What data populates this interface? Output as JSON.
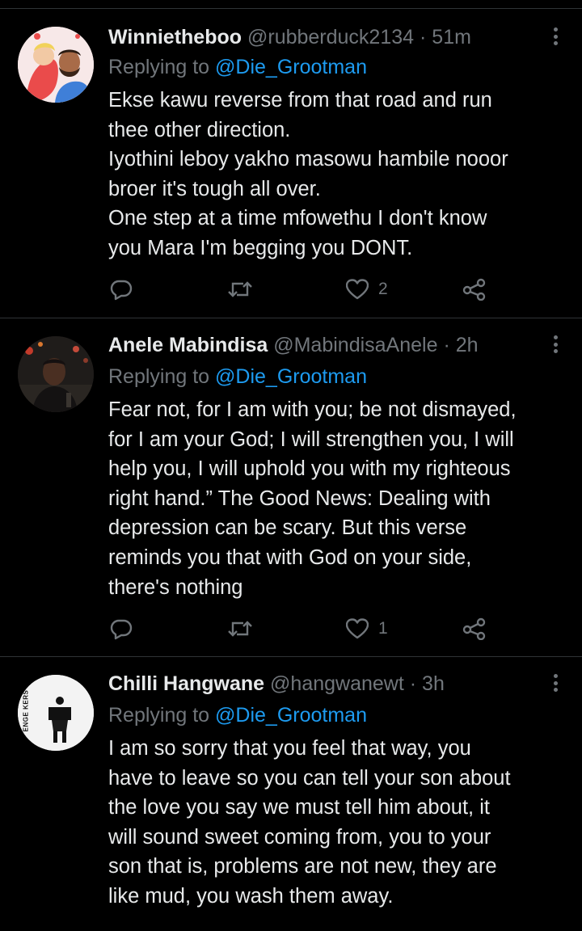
{
  "colors": {
    "background": "#000000",
    "text": "#e7e9ea",
    "secondary": "#71767b",
    "link": "#1d9bf0",
    "divider": "#2f3336"
  },
  "tweets": [
    {
      "display_name": "Winnietheboo",
      "handle": "@rubberduck2134",
      "separator": "·",
      "time": "51m",
      "replying_to_label": "Replying to",
      "replying_to_handle": "@Die_Grootman",
      "lines": [
        "Ekse kawu reverse from that road and run",
        "thee other direction.",
        "Iyothini leboy yakho masowu hambile nooor",
        "broer it's tough all over.",
        "One step at a time mfowethu I don't know",
        "you Mara I'm begging you DONT."
      ],
      "likes": "2",
      "icons": [
        "reply-icon",
        "retweet-icon",
        "like-icon",
        "share-icon",
        "more-icon"
      ]
    },
    {
      "display_name": "Anele Mabindisa",
      "handle": "@MabindisaAnele",
      "separator": "·",
      "time": "2h",
      "replying_to_label": "Replying to",
      "replying_to_handle": "@Die_Grootman",
      "lines": [
        "Fear not, for I am with you; be not dismayed,",
        "for I am your God; I will strengthen you, I will",
        "help you, I will uphold you with my righteous",
        "right hand.” The Good News: Dealing with",
        "depression can be scary. But this verse",
        "reminds you that with God on your side,",
        "there's nothing"
      ],
      "likes": "1",
      "icons": [
        "reply-icon",
        "retweet-icon",
        "like-icon",
        "share-icon",
        "more-icon"
      ]
    },
    {
      "display_name": "Chilli Hangwane",
      "handle": "@hangwanewt",
      "separator": "·",
      "time": "3h",
      "replying_to_label": "Replying to",
      "replying_to_handle": "@Die_Grootman",
      "lines": [
        "I am so sorry that you feel that way, you",
        "have to leave so you can tell your son about",
        "the love you say we must tell him about, it",
        "will sound sweet coming from, you to your",
        "son that is, problems are not new, they are",
        "like mud, you wash them away."
      ],
      "avatar_text": "ENGE  KERS",
      "icons": [
        "more-icon"
      ]
    }
  ]
}
